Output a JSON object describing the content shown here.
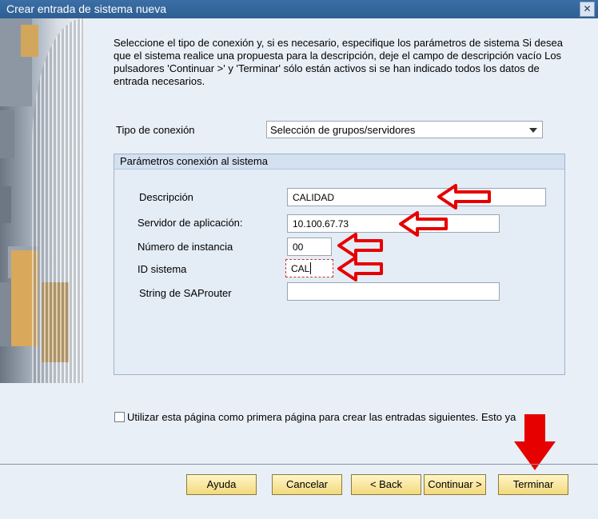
{
  "window": {
    "title": "Crear entrada de sistema nueva",
    "close_label": "✕"
  },
  "intro_text": "Seleccione el tipo de conexión y, si es necesario, especifique los parámetros de sistema Si desea que el sistema realice una propuesta para la descripción, deje el campo de descripción vacío Los pulsadores 'Continuar >' y 'Terminar' sólo están activos si se han indicado todos los datos de entrada necesarios.",
  "connection_type": {
    "label": "Tipo de conexión",
    "value": "Selección de grupos/servidores"
  },
  "group": {
    "title": "Parámetros conexión al sistema",
    "fields": [
      {
        "label": "Descripción",
        "value": "CALIDAD"
      },
      {
        "label": "Servidor de aplicación:",
        "value": "10.100.67.73"
      },
      {
        "label": "Número de instancia",
        "value": "00"
      },
      {
        "label": "ID sistema",
        "value": "CAL"
      },
      {
        "label": "String de SAProuter",
        "value": ""
      }
    ]
  },
  "checkbox_label": "Utilizar esta página como primera página para crear las entradas siguientes. Esto ya",
  "buttons": {
    "help": "Ayuda",
    "cancel": "Cancelar",
    "back": "< Back",
    "continue": "Continuar >",
    "finish": "Terminar"
  },
  "colors": {
    "accent_arrow": "#e60000",
    "button_fill": "#f3d97c",
    "titlebar": "#3a6ea5"
  }
}
